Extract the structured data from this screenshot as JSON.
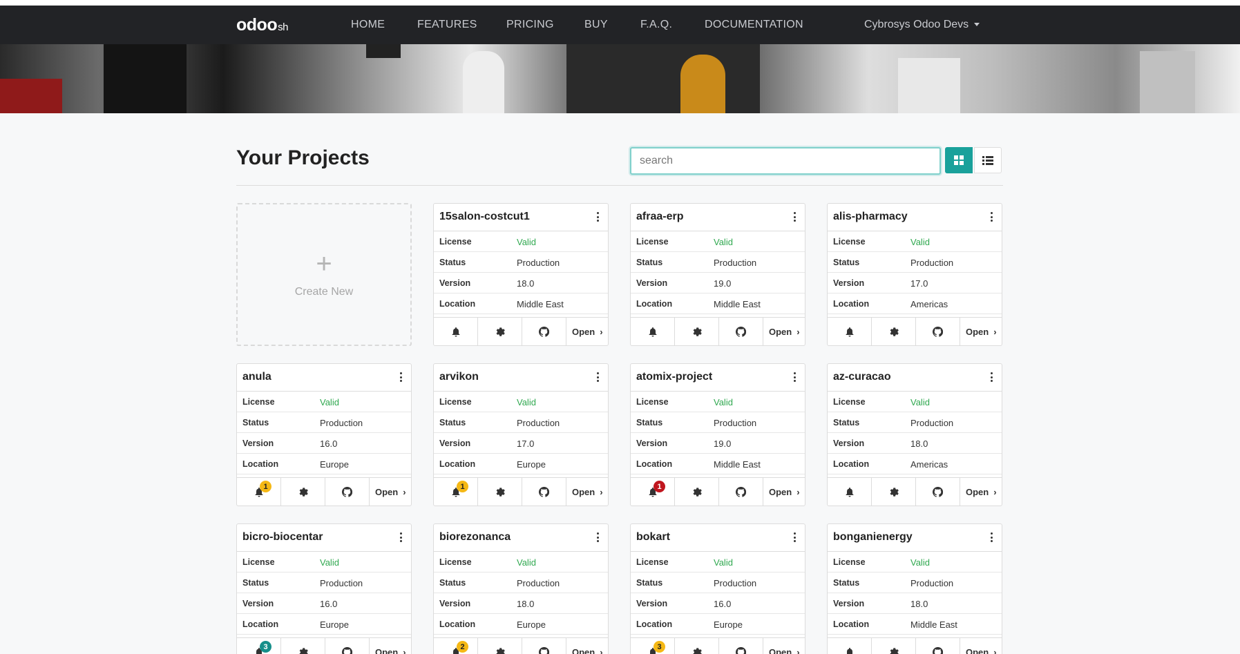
{
  "nav": {
    "logo_main": "odoo",
    "logo_sub": "sh",
    "links": [
      "HOME",
      "FEATURES",
      "PRICING",
      "BUY",
      "F.A.Q.",
      "DOCUMENTATION"
    ],
    "user": "Cybrosys Odoo Devs"
  },
  "main": {
    "title": "Your Projects",
    "search_placeholder": "search",
    "create_label": "Create New",
    "open_label": "Open",
    "field_labels": {
      "license": "License",
      "status": "Status",
      "version": "Version",
      "location": "Location"
    }
  },
  "colors": {
    "accent": "#1aa19b",
    "valid": "#2fa84f",
    "badge_warning": "#f5b815",
    "badge_danger": "#c0161e",
    "badge_info": "#168f8a"
  },
  "projects": [
    {
      "name": "15salon-costcut1",
      "license": "Valid",
      "status": "Production",
      "version": "18.0",
      "location": "Middle East",
      "badge": "",
      "badge_type": ""
    },
    {
      "name": "afraa-erp",
      "license": "Valid",
      "status": "Production",
      "version": "19.0",
      "location": "Middle East",
      "badge": "",
      "badge_type": ""
    },
    {
      "name": "alis-pharmacy",
      "license": "Valid",
      "status": "Production",
      "version": "17.0",
      "location": "Americas",
      "badge": "",
      "badge_type": ""
    },
    {
      "name": "anula",
      "license": "Valid",
      "status": "Production",
      "version": "16.0",
      "location": "Europe",
      "badge": "1",
      "badge_type": "warn"
    },
    {
      "name": "arvikon",
      "license": "Valid",
      "status": "Production",
      "version": "17.0",
      "location": "Europe",
      "badge": "1",
      "badge_type": "warn"
    },
    {
      "name": "atomix-project",
      "license": "Valid",
      "status": "Production",
      "version": "19.0",
      "location": "Middle East",
      "badge": "1",
      "badge_type": "danger"
    },
    {
      "name": "az-curacao",
      "license": "Valid",
      "status": "Production",
      "version": "18.0",
      "location": "Americas",
      "badge": "",
      "badge_type": ""
    },
    {
      "name": "bicro-biocentar",
      "license": "Valid",
      "status": "Production",
      "version": "16.0",
      "location": "Europe",
      "badge": "3",
      "badge_type": "info"
    },
    {
      "name": "biorezonanca",
      "license": "Valid",
      "status": "Production",
      "version": "18.0",
      "location": "Europe",
      "badge": "2",
      "badge_type": "warn"
    },
    {
      "name": "bokart",
      "license": "Valid",
      "status": "Production",
      "version": "16.0",
      "location": "Europe",
      "badge": "3",
      "badge_type": "warn"
    },
    {
      "name": "bonganienergy",
      "license": "Valid",
      "status": "Production",
      "version": "18.0",
      "location": "Middle East",
      "badge": "",
      "badge_type": ""
    }
  ]
}
